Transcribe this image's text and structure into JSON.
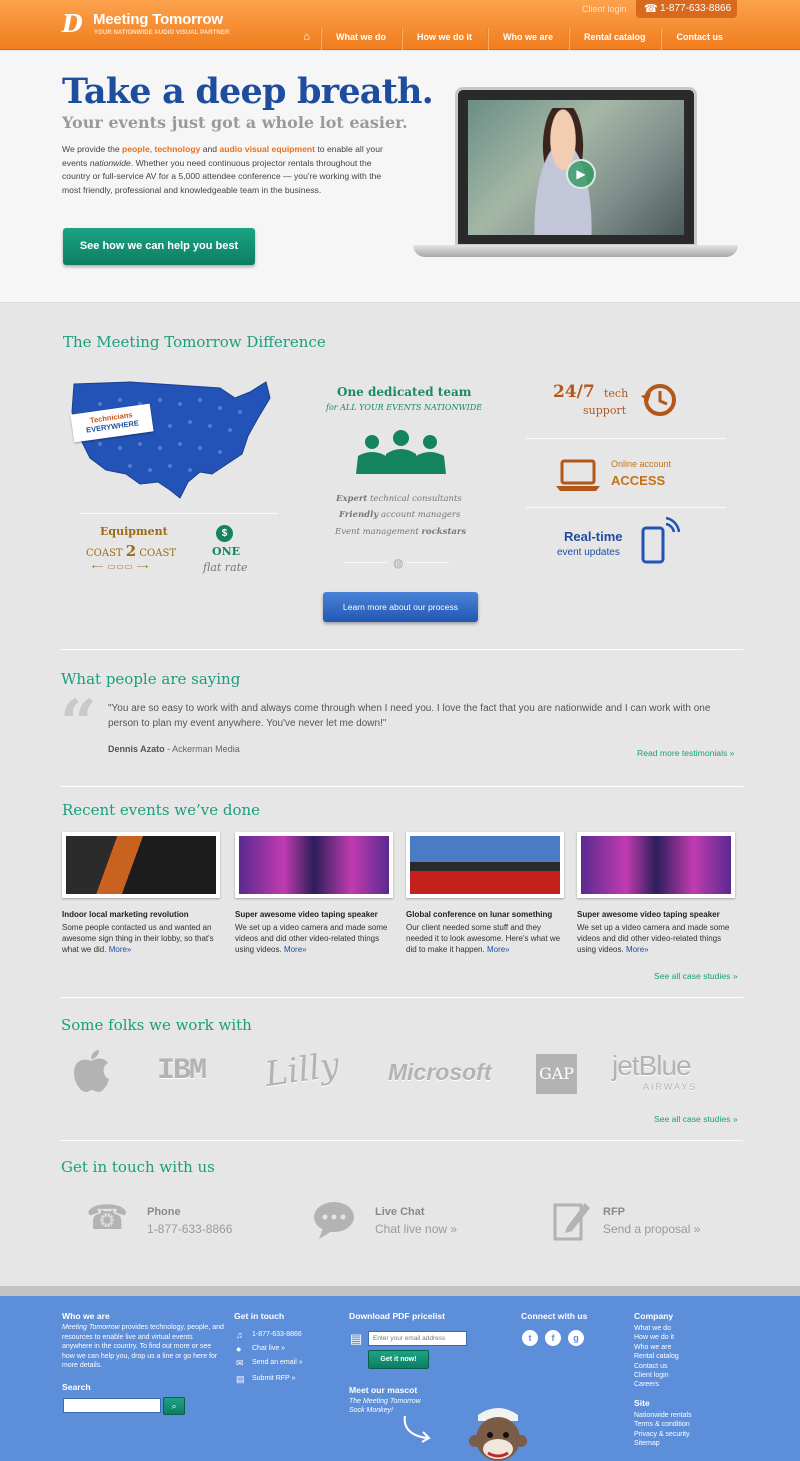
{
  "header": {
    "logo_name": "Meeting Tomorrow",
    "logo_tagline": "YOUR NATIONWIDE AUDIO VISUAL PARTNER",
    "client_login": "Client login",
    "phone": "1-877-633-8866",
    "nav": [
      "What we do",
      "How we do it",
      "Who we are",
      "Rental catalog",
      "Contact us"
    ]
  },
  "hero": {
    "title": "Take a deep breath.",
    "subtitle": "Your events just got a whole lot easier.",
    "text_1": "We provide the ",
    "highlight_1": "people",
    "text_2": ", ",
    "highlight_2": "technology",
    "text_3": " and ",
    "highlight_3": "audio visual equipment",
    "text_4": " to enable all your events ",
    "text_italic": "nationwide",
    "text_5": ". Whether you need continuous projector rentals throughout the country or full-service AV for a 5,000 attendee conference — you're working with the most friendly, professional and knowledgeable team in the business.",
    "cta": "See how we can help you best"
  },
  "difference": {
    "title": "The Meeting Tomorrow Difference",
    "badge_line1": "Technicians",
    "badge_line2": "EVERYWHERE",
    "equipment": "Equipment",
    "coast_left": "COAST",
    "coast_num": "2",
    "coast_right": "COAST",
    "one": "ONE",
    "flat_rate": "flat rate",
    "team_title": "One dedicated team",
    "team_sub": "for ALL YOUR EVENTS NATIONWIDE",
    "team_lines": [
      {
        "em": "Expert",
        "rest": " technical consultants"
      },
      {
        "em": "Friendly",
        "rest": " account managers"
      },
      {
        "pre": "Event management ",
        "em": "rockstars"
      }
    ],
    "process_button": "Learn more about our process",
    "tech_247": "24/7",
    "tech_word": "tech",
    "tech_support": "support",
    "online_account": "Online account",
    "access": "ACCESS",
    "realtime": "Real-time",
    "event_updates": "event updates"
  },
  "testimonials": {
    "title": "What people are saying",
    "quote": "\"You are so easy to work with and always come through when I need you. I love the fact that you are nationwide and I can work with one person to plan my event anywhere. You've never let me down!\"",
    "author": "Dennis Azato",
    "company": " - Ackerman Media",
    "read_more": "Read more testimonials »"
  },
  "events": {
    "title": "Recent events we’ve done",
    "items": [
      {
        "title": "Indoor local marketing revolution",
        "desc": "Some people contacted us and wanted an awesome sign thing in their lobby, so that's what we did.",
        "more": "More»"
      },
      {
        "title": "Super awesome video taping speaker",
        "desc": "We set up a video camera and made some videos and did other video-related things using videos.",
        "more": "More»"
      },
      {
        "title": "Global conference on lunar something",
        "desc": "Our client needed some stuff and they needed it to look awesome. Here's what we did to make it happen.",
        "more": "More»"
      },
      {
        "title": "Super awesome video taping speaker",
        "desc": "We set up a video camera and made some videos and did other video-related things using videos.",
        "more": "More»"
      }
    ],
    "see_all": "See all case studies »"
  },
  "clients": {
    "title": "Some folks we work with",
    "logos": [
      "IBM",
      "Lilly",
      "Microsoft",
      "GAP",
      "jetBlue",
      "AIRWAYS"
    ],
    "see_all": "See all case studies »"
  },
  "contact": {
    "title": "Get in touch with us",
    "phone_label": "Phone",
    "phone_value": "1-877-633-8866",
    "chat_label": "Live Chat",
    "chat_value": "Chat live now »",
    "rfp_label": "RFP",
    "rfp_value": "Send a proposal »"
  },
  "footer": {
    "who_title": "Who we are",
    "who_em": "Meeting Tomorrow",
    "who_text": " provides technology, people, and resources to enable live and virtual events anywhere in the country. To find out more or see how we can help you, drop us a line or go here for more details.",
    "search_title": "Search",
    "touch_title": "Get in touch",
    "touch_links": [
      "1-877-633-8866",
      "Chat live »",
      "Send an email »",
      "Submit RFP »"
    ],
    "pdf_title": "Download PDF pricelist",
    "email_placeholder": "Enter your email address",
    "get_it": "Get it now!",
    "mascot_title": "Meet our mascot",
    "mascot_text": "The Meeting Tomorrow Sock Monkey!",
    "connect_title": "Connect with us",
    "company_title": "Company",
    "company_links": [
      "What we do",
      "How we do it",
      "Who we are",
      "Rental catalog",
      "Contact us",
      "Client login",
      "Careers"
    ],
    "site_title": "Site",
    "site_links": [
      "Nationwide rentals",
      "Terms & condition",
      "Privacy & security",
      "Sitemap"
    ]
  }
}
